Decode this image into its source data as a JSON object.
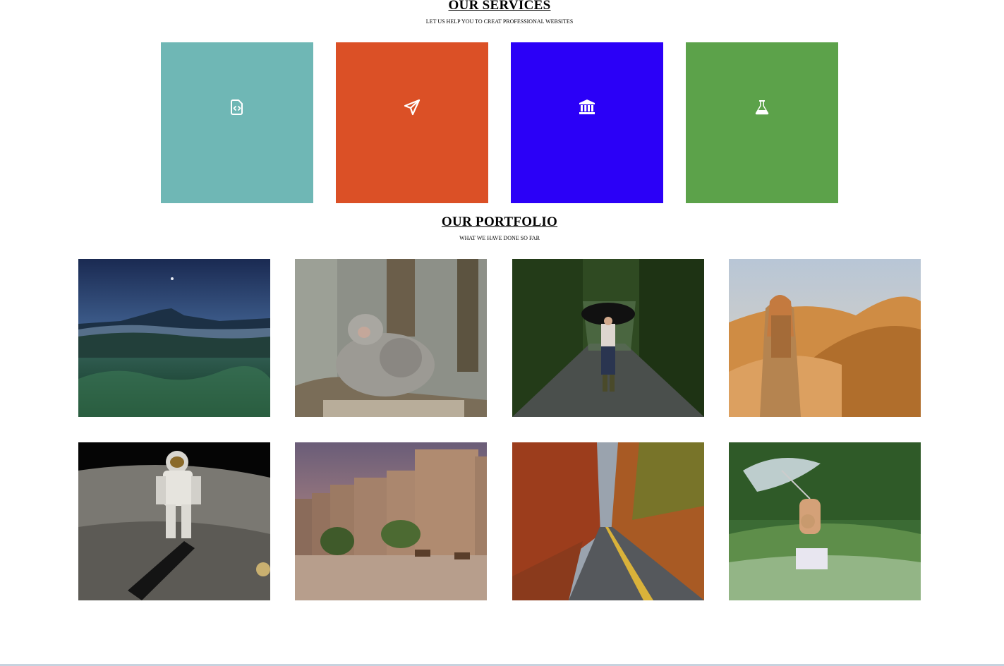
{
  "services": {
    "title": "OUR SERVICES",
    "subtitle": "LET US HELP YOU TO CREAT PROFESSIONAL WEBSITES",
    "cards": [
      {
        "color": "#6fb7b5",
        "icon": "file-code-icon"
      },
      {
        "color": "#db5026",
        "icon": "paper-plane-icon"
      },
      {
        "color": "#2b00f7",
        "icon": "bank-icon"
      },
      {
        "color": "#5ca24a",
        "icon": "flask-icon"
      }
    ]
  },
  "portfolio": {
    "title": "OUR PORTFOLIO",
    "subtitle": "WHAT WE HAVE DONE SO FAR",
    "photos": [
      {
        "subject": "mountain-night-photo"
      },
      {
        "subject": "monkeys-photo"
      },
      {
        "subject": "woman-umbrella-road-photo"
      },
      {
        "subject": "desert-traveler-photo"
      },
      {
        "subject": "astronaut-moon-photo"
      },
      {
        "subject": "fort-camels-photo"
      },
      {
        "subject": "autumn-road-photo"
      },
      {
        "subject": "woman-field-umbrella-photo"
      }
    ]
  }
}
